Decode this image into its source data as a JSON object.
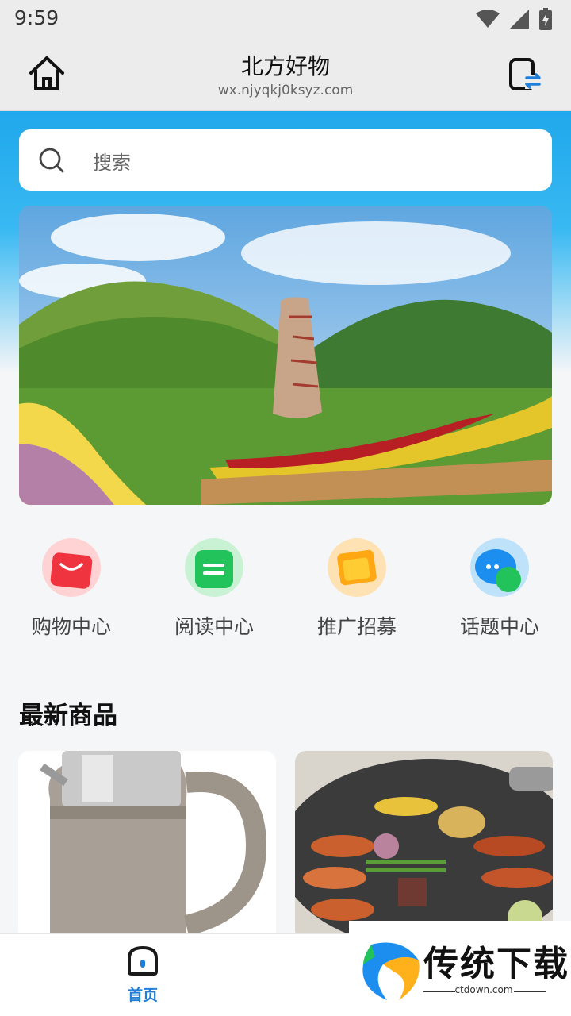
{
  "status_bar": {
    "time": "9:59"
  },
  "title_bar": {
    "title": "北方好物",
    "url": "wx.njyqkj0ksyz.com"
  },
  "search": {
    "placeholder": "搜索"
  },
  "categories": [
    {
      "label": "购物中心",
      "icon": "shopping-bag-icon",
      "color": "#f0343f"
    },
    {
      "label": "阅读中心",
      "icon": "reading-icon",
      "color": "#22c35a"
    },
    {
      "label": "推广招募",
      "icon": "recruit-icon",
      "color": "#ffa814"
    },
    {
      "label": "话题中心",
      "icon": "chat-icon",
      "color": "#1c8ef0"
    }
  ],
  "section": {
    "latest_products": "最新商品"
  },
  "tab_bar": {
    "home_label": "首页"
  },
  "watermark": {
    "brand": "传统下载",
    "domain": "ctdown.com"
  },
  "colors": {
    "accent": "#1f7fd8",
    "header_blue": "#1fa8ec"
  }
}
